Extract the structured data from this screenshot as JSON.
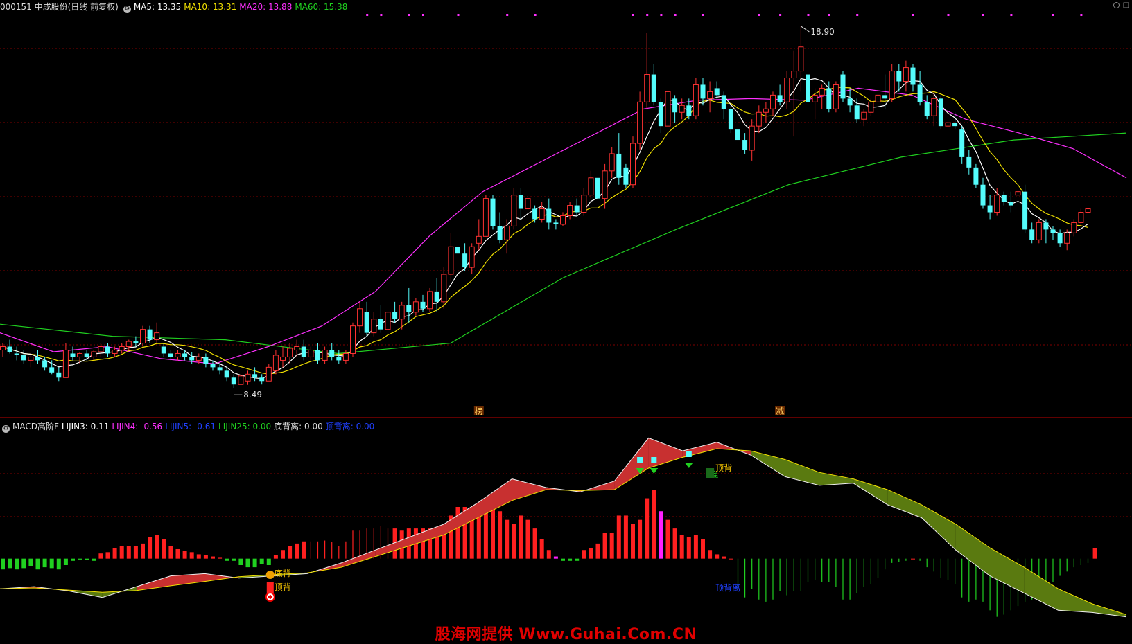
{
  "header": {
    "code_name": "000151 中成股份(日线 前复权)",
    "ma": [
      {
        "label": "MA5: 13.35",
        "color": "#ffffff"
      },
      {
        "label": "MA10: 13.31",
        "color": "#f0e000"
      },
      {
        "label": "MA20: 13.88",
        "color": "#ff30ff"
      },
      {
        "label": "MA60: 15.38",
        "color": "#20d020"
      }
    ]
  },
  "sub_header": {
    "name": "MACD高阶F",
    "items": [
      {
        "label": "LIJIN3: 0.11",
        "color": "#ffffff"
      },
      {
        "label": "LIJIN4: -0.56",
        "color": "#ff30ff"
      },
      {
        "label": "LIJIN5: -0.61",
        "color": "#2040ff"
      },
      {
        "label": "LIJIN25: 0.00",
        "color": "#20d020"
      },
      {
        "label": "底背离: 0.00",
        "color": "#dddddd"
      },
      {
        "label": "顶背离: 0.00",
        "color": "#2040ff"
      }
    ]
  },
  "colors": {
    "up": "#ff3232",
    "down": "#54fcfc",
    "ma5": "#ffffff",
    "ma10": "#f0e000",
    "ma20": "#ff30ff",
    "ma60": "#20d020",
    "grid": "#800000"
  },
  "watermark": "股海网提供 Www.Guhai.Com.CN",
  "chart_data": {
    "type": "candlestick",
    "price_range": [
      7.6,
      19.3
    ],
    "high_label": "18.90",
    "low_label": "8.49",
    "markers": [
      {
        "index": 68,
        "text": "榜"
      },
      {
        "index": 111,
        "text": "减"
      }
    ],
    "candles": [
      [
        9.5,
        9.7,
        9.3,
        9.6
      ],
      [
        9.6,
        9.8,
        9.4,
        9.45
      ],
      [
        9.4,
        9.6,
        9.2,
        9.35
      ],
      [
        9.35,
        9.5,
        9.1,
        9.2
      ],
      [
        9.2,
        9.4,
        9.0,
        9.3
      ],
      [
        9.3,
        9.5,
        9.1,
        9.2
      ],
      [
        9.2,
        9.3,
        8.9,
        9.0
      ],
      [
        9.0,
        9.2,
        8.8,
        8.85
      ],
      [
        8.85,
        9.0,
        8.6,
        8.7
      ],
      [
        8.7,
        9.7,
        8.7,
        9.5
      ],
      [
        9.4,
        9.6,
        9.2,
        9.3
      ],
      [
        9.3,
        9.45,
        9.1,
        9.4
      ],
      [
        9.4,
        9.5,
        9.2,
        9.3
      ],
      [
        9.3,
        9.5,
        9.2,
        9.45
      ],
      [
        9.45,
        9.7,
        9.3,
        9.6
      ],
      [
        9.6,
        9.7,
        9.3,
        9.4
      ],
      [
        9.4,
        9.6,
        9.3,
        9.5
      ],
      [
        9.5,
        9.7,
        9.4,
        9.6
      ],
      [
        9.6,
        9.8,
        9.5,
        9.75
      ],
      [
        9.75,
        9.9,
        9.6,
        9.7
      ],
      [
        9.7,
        10.2,
        9.6,
        10.1
      ],
      [
        10.1,
        10.2,
        9.7,
        9.8
      ],
      [
        9.8,
        10.3,
        9.7,
        10.0
      ],
      [
        9.6,
        9.7,
        9.3,
        9.4
      ],
      [
        9.4,
        9.5,
        9.2,
        9.3
      ],
      [
        9.3,
        9.5,
        9.2,
        9.4
      ],
      [
        9.4,
        9.5,
        9.2,
        9.3
      ],
      [
        9.3,
        9.45,
        9.1,
        9.2
      ],
      [
        9.2,
        9.4,
        9.1,
        9.3
      ],
      [
        9.3,
        9.4,
        9.0,
        9.1
      ],
      [
        9.1,
        9.2,
        8.9,
        9.0
      ],
      [
        9.0,
        9.1,
        8.8,
        8.9
      ],
      [
        8.9,
        9.0,
        8.6,
        8.7
      ],
      [
        8.7,
        8.8,
        8.4,
        8.5
      ],
      [
        8.5,
        8.8,
        8.5,
        8.75
      ],
      [
        8.6,
        8.9,
        8.49,
        8.8
      ],
      [
        8.8,
        9.0,
        8.6,
        8.7
      ],
      [
        8.7,
        8.8,
        8.5,
        8.6
      ],
      [
        8.6,
        9.1,
        8.6,
        9.0
      ],
      [
        8.9,
        9.5,
        8.8,
        9.35
      ],
      [
        9.2,
        9.6,
        9.0,
        9.3
      ],
      [
        9.3,
        9.7,
        9.1,
        9.55
      ],
      [
        9.5,
        9.8,
        9.3,
        9.6
      ],
      [
        9.6,
        9.8,
        9.2,
        9.3
      ],
      [
        9.3,
        9.6,
        9.2,
        9.5
      ],
      [
        9.5,
        9.7,
        9.1,
        9.2
      ],
      [
        9.2,
        9.6,
        9.1,
        9.5
      ],
      [
        9.5,
        9.7,
        9.2,
        9.3
      ],
      [
        9.3,
        9.5,
        9.1,
        9.2
      ],
      [
        9.2,
        9.5,
        9.1,
        9.4
      ],
      [
        9.4,
        10.3,
        9.3,
        10.2
      ],
      [
        10.2,
        10.9,
        10.0,
        10.7
      ],
      [
        10.6,
        10.9,
        9.9,
        10.0
      ],
      [
        10.0,
        10.6,
        9.9,
        10.4
      ],
      [
        10.4,
        10.8,
        10.0,
        10.1
      ],
      [
        10.1,
        10.7,
        10.0,
        10.6
      ],
      [
        10.6,
        10.9,
        10.3,
        10.4
      ],
      [
        10.4,
        10.9,
        10.1,
        10.8
      ],
      [
        10.8,
        11.3,
        10.3,
        10.6
      ],
      [
        10.6,
        11.0,
        10.5,
        10.9
      ],
      [
        10.9,
        11.1,
        10.6,
        10.7
      ],
      [
        10.7,
        11.3,
        10.6,
        11.2
      ],
      [
        11.2,
        11.6,
        10.6,
        10.9
      ],
      [
        10.9,
        11.9,
        10.7,
        11.7
      ],
      [
        11.7,
        12.9,
        11.5,
        12.5
      ],
      [
        12.5,
        12.9,
        12.2,
        12.3
      ],
      [
        12.3,
        12.6,
        11.8,
        11.9
      ],
      [
        11.9,
        12.6,
        11.7,
        12.5
      ],
      [
        12.6,
        13.3,
        12.4,
        12.8
      ],
      [
        12.8,
        14.0,
        12.8,
        13.9
      ],
      [
        13.9,
        14.0,
        13.0,
        13.1
      ],
      [
        13.1,
        13.5,
        12.6,
        12.7
      ],
      [
        12.7,
        13.3,
        12.3,
        13.1
      ],
      [
        13.1,
        14.2,
        13.0,
        14.0
      ],
      [
        14.0,
        14.2,
        13.3,
        13.6
      ],
      [
        13.6,
        14.0,
        13.3,
        13.9
      ],
      [
        13.6,
        13.7,
        13.2,
        13.3
      ],
      [
        13.3,
        13.8,
        13.2,
        13.6
      ],
      [
        13.6,
        13.9,
        13.0,
        13.2
      ],
      [
        13.2,
        13.3,
        13.0,
        13.15
      ],
      [
        13.15,
        13.5,
        13.1,
        13.4
      ],
      [
        13.4,
        13.8,
        13.3,
        13.7
      ],
      [
        13.7,
        13.9,
        13.4,
        13.5
      ],
      [
        13.5,
        14.2,
        13.4,
        14.0
      ],
      [
        14.0,
        14.7,
        13.9,
        14.5
      ],
      [
        14.5,
        14.7,
        13.8,
        13.9
      ],
      [
        13.9,
        14.9,
        13.6,
        14.7
      ],
      [
        14.7,
        15.4,
        14.5,
        15.2
      ],
      [
        15.2,
        15.8,
        14.3,
        14.5
      ],
      [
        14.8,
        14.9,
        14.2,
        14.3
      ],
      [
        14.3,
        15.7,
        14.2,
        15.5
      ],
      [
        15.5,
        17.0,
        15.3,
        16.7
      ],
      [
        16.7,
        18.7,
        16.5,
        17.5
      ],
      [
        17.5,
        17.8,
        16.6,
        16.7
      ],
      [
        16.7,
        16.8,
        15.8,
        16.0
      ],
      [
        16.0,
        17.2,
        15.9,
        17.0
      ],
      [
        16.8,
        16.9,
        16.1,
        16.4
      ],
      [
        16.4,
        16.8,
        16.2,
        16.6
      ],
      [
        16.6,
        16.8,
        16.2,
        16.3
      ],
      [
        16.3,
        17.4,
        16.2,
        17.2
      ],
      [
        17.2,
        17.4,
        16.6,
        16.8
      ],
      [
        16.8,
        17.3,
        16.4,
        17.0
      ],
      [
        17.1,
        17.3,
        16.8,
        16.9
      ],
      [
        16.9,
        17.0,
        16.2,
        16.5
      ],
      [
        16.5,
        16.6,
        15.8,
        15.9
      ],
      [
        15.9,
        16.1,
        15.5,
        15.6
      ],
      [
        15.6,
        15.8,
        15.2,
        15.3
      ],
      [
        15.3,
        16.2,
        15.0,
        16.0
      ],
      [
        16.0,
        16.6,
        15.8,
        16.4
      ],
      [
        16.4,
        16.7,
        16.1,
        16.5
      ],
      [
        16.5,
        17.0,
        16.3,
        16.9
      ],
      [
        16.9,
        17.2,
        16.6,
        16.7
      ],
      [
        16.7,
        17.6,
        16.5,
        17.4
      ],
      [
        17.4,
        18.2,
        15.7,
        17.6
      ],
      [
        17.6,
        18.9,
        17.0,
        18.3
      ],
      [
        17.5,
        17.7,
        16.6,
        16.7
      ],
      [
        16.7,
        17.1,
        16.2,
        16.9
      ],
      [
        16.9,
        17.2,
        16.5,
        17.1
      ],
      [
        17.1,
        17.3,
        16.4,
        16.5
      ],
      [
        16.5,
        17.3,
        16.4,
        17.2
      ],
      [
        17.5,
        17.6,
        16.7,
        16.8
      ],
      [
        16.8,
        17.1,
        16.4,
        16.6
      ],
      [
        16.6,
        16.8,
        16.1,
        16.2
      ],
      [
        16.2,
        16.5,
        16.0,
        16.4
      ],
      [
        16.4,
        16.8,
        16.3,
        16.7
      ],
      [
        16.7,
        17.0,
        16.5,
        16.9
      ],
      [
        16.9,
        17.5,
        16.5,
        16.8
      ],
      [
        16.8,
        17.8,
        16.7,
        17.6
      ],
      [
        17.6,
        17.8,
        17.0,
        17.3
      ],
      [
        17.3,
        17.9,
        17.0,
        17.7
      ],
      [
        17.7,
        17.8,
        17.0,
        17.2
      ],
      [
        17.2,
        17.6,
        16.6,
        16.7
      ],
      [
        16.7,
        16.9,
        16.2,
        16.3
      ],
      [
        16.3,
        17.0,
        16.0,
        16.8
      ],
      [
        16.8,
        16.9,
        15.9,
        16.0
      ],
      [
        16.0,
        16.3,
        15.8,
        16.1
      ],
      [
        16.1,
        16.4,
        15.9,
        16.0
      ],
      [
        15.9,
        16.0,
        14.9,
        15.1
      ],
      [
        15.1,
        15.3,
        14.6,
        14.8
      ],
      [
        14.8,
        14.9,
        14.2,
        14.3
      ],
      [
        14.3,
        14.5,
        13.6,
        13.7
      ],
      [
        13.7,
        14.0,
        13.3,
        13.5
      ],
      [
        13.5,
        14.2,
        13.4,
        14.0
      ],
      [
        14.0,
        14.1,
        13.7,
        13.8
      ],
      [
        13.8,
        14.1,
        13.5,
        13.7
      ],
      [
        14.0,
        14.6,
        13.7,
        14.1
      ],
      [
        14.1,
        14.3,
        12.9,
        13.0
      ],
      [
        13.0,
        13.2,
        12.6,
        12.7
      ],
      [
        12.7,
        13.3,
        12.6,
        13.2
      ],
      [
        13.2,
        13.3,
        12.6,
        13.0
      ],
      [
        13.0,
        13.1,
        12.7,
        12.9
      ],
      [
        12.9,
        13.0,
        12.5,
        12.6
      ],
      [
        12.6,
        13.0,
        12.4,
        12.9
      ],
      [
        12.9,
        13.3,
        12.8,
        13.2
      ],
      [
        13.2,
        13.6,
        13.1,
        13.5
      ],
      [
        13.5,
        13.8,
        13.3,
        13.6
      ]
    ],
    "ma60_points": [
      10.25,
      9.9,
      9.8,
      9.4,
      9.7,
      11.6,
      13.0,
      14.3,
      15.1,
      15.6,
      15.8
    ],
    "ma20_points": [
      10.0,
      9.45,
      9.6,
      9.25,
      9.1,
      9.6,
      10.2,
      11.2,
      12.8,
      14.1,
      14.9,
      15.7,
      16.5,
      16.75,
      16.8,
      16.75,
      17.1,
      16.9,
      16.2,
      15.8,
      15.35,
      14.5
    ],
    "macd_panel": {
      "range": [
        -1.5,
        3.0
      ],
      "bars": [
        -0.25,
        -0.22,
        -0.25,
        -0.22,
        -0.18,
        -0.25,
        -0.2,
        -0.22,
        -0.25,
        -0.15,
        -0.05,
        -0.02,
        -0.03,
        -0.05,
        0.12,
        0.15,
        0.25,
        0.3,
        0.3,
        0.3,
        0.35,
        0.5,
        0.55,
        0.45,
        0.3,
        0.22,
        0.18,
        0.15,
        0.1,
        0.08,
        0.05,
        0.02,
        -0.05,
        -0.05,
        -0.15,
        -0.2,
        -0.2,
        -0.12,
        -0.15,
        0.08,
        0.2,
        0.3,
        0.35,
        0.4,
        0.4,
        0.4,
        0.42,
        0.38,
        0.3,
        0.4,
        0.65,
        0.65,
        0.7,
        0.7,
        0.75,
        0.7,
        0.7,
        0.65,
        0.7,
        0.7,
        0.7,
        0.7,
        0.7,
        0.75,
        1.0,
        1.2,
        1.2,
        1.0,
        1.0,
        1.1,
        1.2,
        1.1,
        0.9,
        0.8,
        1.0,
        0.9,
        0.7,
        0.45,
        0.2,
        0.05,
        -0.05,
        -0.05,
        -0.05,
        0.2,
        0.25,
        0.35,
        0.6,
        0.6,
        1.0,
        1.0,
        0.8,
        0.9,
        1.4,
        1.6,
        1.1,
        0.9,
        0.7,
        0.55,
        0.5,
        0.55,
        0.45,
        0.2,
        0.1,
        0.05,
        0.0,
        -0.7,
        -0.9,
        -0.7,
        -0.95,
        -1.0,
        -0.95,
        -0.75,
        -0.85,
        -0.75,
        -0.75,
        -0.55,
        -0.5,
        -0.55,
        -0.55,
        -0.65,
        -0.95,
        -0.95,
        -0.8,
        -0.65,
        -0.6,
        -0.45,
        -0.25,
        -0.1,
        -0.08,
        -0.05,
        0.0,
        -0.05,
        -0.2,
        -0.3,
        -0.45,
        -0.5,
        -0.6,
        -0.9,
        -1.0,
        -0.95,
        -1.0,
        -1.2,
        -1.35,
        -1.3,
        -1.2,
        -1.1,
        -1.0,
        -0.95,
        -0.8,
        -0.7,
        -0.55,
        -0.4,
        -0.3,
        -0.2,
        -0.15,
        -0.1,
        0.25
      ],
      "dif_points": [
        -0.7,
        -0.65,
        -0.75,
        -0.9,
        -0.65,
        -0.4,
        -0.35,
        -0.45,
        -0.4,
        -0.35,
        -0.1,
        0.2,
        0.5,
        0.8,
        1.3,
        1.85,
        1.65,
        1.55,
        1.8,
        2.8,
        2.5,
        2.7,
        2.4,
        1.9,
        1.7,
        1.75,
        1.25,
        0.95,
        0.2,
        -0.4,
        -0.8,
        -1.2,
        -1.25,
        -1.35
      ],
      "dea_points": [
        -0.7,
        -0.68,
        -0.73,
        -0.78,
        -0.74,
        -0.63,
        -0.53,
        -0.42,
        -0.37,
        -0.33,
        -0.2,
        0.05,
        0.3,
        0.55,
        0.95,
        1.35,
        1.6,
        1.58,
        1.6,
        2.1,
        2.35,
        2.55,
        2.5,
        2.3,
        2.0,
        1.85,
        1.6,
        1.25,
        0.8,
        0.25,
        -0.2,
        -0.7,
        -1.05,
        -1.3
      ],
      "labels": [
        {
          "index": 38,
          "text": "底背",
          "color": "#f0c000"
        },
        {
          "index": 38,
          "text": "顶背",
          "color": "#f0c000"
        },
        {
          "index": 101,
          "text": "顶背",
          "color": "#f0c000"
        },
        {
          "index": 101,
          "text": "底",
          "color": "#20d020"
        },
        {
          "index": 101,
          "text": "顶背离",
          "color": "#2040ff"
        }
      ]
    }
  }
}
